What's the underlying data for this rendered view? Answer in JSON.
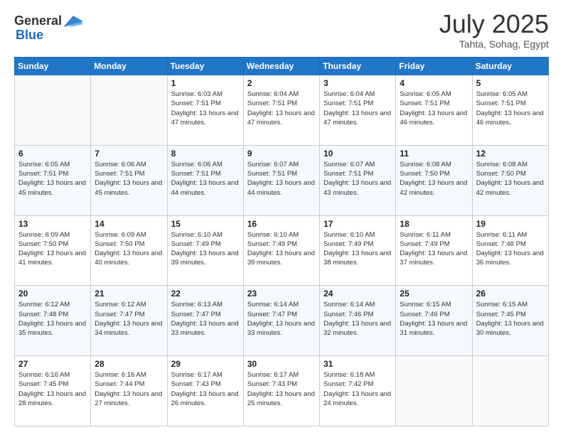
{
  "header": {
    "logo_general": "General",
    "logo_blue": "Blue",
    "title": "July 2025",
    "location": "Tahta, Sohag, Egypt"
  },
  "weekdays": [
    "Sunday",
    "Monday",
    "Tuesday",
    "Wednesday",
    "Thursday",
    "Friday",
    "Saturday"
  ],
  "weeks": [
    [
      {
        "day": "",
        "info": ""
      },
      {
        "day": "",
        "info": ""
      },
      {
        "day": "1",
        "info": "Sunrise: 6:03 AM\nSunset: 7:51 PM\nDaylight: 13 hours and 47 minutes."
      },
      {
        "day": "2",
        "info": "Sunrise: 6:04 AM\nSunset: 7:51 PM\nDaylight: 13 hours and 47 minutes."
      },
      {
        "day": "3",
        "info": "Sunrise: 6:04 AM\nSunset: 7:51 PM\nDaylight: 13 hours and 47 minutes."
      },
      {
        "day": "4",
        "info": "Sunrise: 6:05 AM\nSunset: 7:51 PM\nDaylight: 13 hours and 46 minutes."
      },
      {
        "day": "5",
        "info": "Sunrise: 6:05 AM\nSunset: 7:51 PM\nDaylight: 13 hours and 46 minutes."
      }
    ],
    [
      {
        "day": "6",
        "info": "Sunrise: 6:05 AM\nSunset: 7:51 PM\nDaylight: 13 hours and 45 minutes."
      },
      {
        "day": "7",
        "info": "Sunrise: 6:06 AM\nSunset: 7:51 PM\nDaylight: 13 hours and 45 minutes."
      },
      {
        "day": "8",
        "info": "Sunrise: 6:06 AM\nSunset: 7:51 PM\nDaylight: 13 hours and 44 minutes."
      },
      {
        "day": "9",
        "info": "Sunrise: 6:07 AM\nSunset: 7:51 PM\nDaylight: 13 hours and 44 minutes."
      },
      {
        "day": "10",
        "info": "Sunrise: 6:07 AM\nSunset: 7:51 PM\nDaylight: 13 hours and 43 minutes."
      },
      {
        "day": "11",
        "info": "Sunrise: 6:08 AM\nSunset: 7:50 PM\nDaylight: 13 hours and 42 minutes."
      },
      {
        "day": "12",
        "info": "Sunrise: 6:08 AM\nSunset: 7:50 PM\nDaylight: 13 hours and 42 minutes."
      }
    ],
    [
      {
        "day": "13",
        "info": "Sunrise: 6:09 AM\nSunset: 7:50 PM\nDaylight: 13 hours and 41 minutes."
      },
      {
        "day": "14",
        "info": "Sunrise: 6:09 AM\nSunset: 7:50 PM\nDaylight: 13 hours and 40 minutes."
      },
      {
        "day": "15",
        "info": "Sunrise: 6:10 AM\nSunset: 7:49 PM\nDaylight: 13 hours and 39 minutes."
      },
      {
        "day": "16",
        "info": "Sunrise: 6:10 AM\nSunset: 7:49 PM\nDaylight: 13 hours and 39 minutes."
      },
      {
        "day": "17",
        "info": "Sunrise: 6:10 AM\nSunset: 7:49 PM\nDaylight: 13 hours and 38 minutes."
      },
      {
        "day": "18",
        "info": "Sunrise: 6:11 AM\nSunset: 7:49 PM\nDaylight: 13 hours and 37 minutes."
      },
      {
        "day": "19",
        "info": "Sunrise: 6:11 AM\nSunset: 7:48 PM\nDaylight: 13 hours and 36 minutes."
      }
    ],
    [
      {
        "day": "20",
        "info": "Sunrise: 6:12 AM\nSunset: 7:48 PM\nDaylight: 13 hours and 35 minutes."
      },
      {
        "day": "21",
        "info": "Sunrise: 6:12 AM\nSunset: 7:47 PM\nDaylight: 13 hours and 34 minutes."
      },
      {
        "day": "22",
        "info": "Sunrise: 6:13 AM\nSunset: 7:47 PM\nDaylight: 13 hours and 33 minutes."
      },
      {
        "day": "23",
        "info": "Sunrise: 6:14 AM\nSunset: 7:47 PM\nDaylight: 13 hours and 33 minutes."
      },
      {
        "day": "24",
        "info": "Sunrise: 6:14 AM\nSunset: 7:46 PM\nDaylight: 13 hours and 32 minutes."
      },
      {
        "day": "25",
        "info": "Sunrise: 6:15 AM\nSunset: 7:46 PM\nDaylight: 13 hours and 31 minutes."
      },
      {
        "day": "26",
        "info": "Sunrise: 6:15 AM\nSunset: 7:45 PM\nDaylight: 13 hours and 30 minutes."
      }
    ],
    [
      {
        "day": "27",
        "info": "Sunrise: 6:16 AM\nSunset: 7:45 PM\nDaylight: 13 hours and 28 minutes."
      },
      {
        "day": "28",
        "info": "Sunrise: 6:16 AM\nSunset: 7:44 PM\nDaylight: 13 hours and 27 minutes."
      },
      {
        "day": "29",
        "info": "Sunrise: 6:17 AM\nSunset: 7:43 PM\nDaylight: 13 hours and 26 minutes."
      },
      {
        "day": "30",
        "info": "Sunrise: 6:17 AM\nSunset: 7:43 PM\nDaylight: 13 hours and 25 minutes."
      },
      {
        "day": "31",
        "info": "Sunrise: 6:18 AM\nSunset: 7:42 PM\nDaylight: 13 hours and 24 minutes."
      },
      {
        "day": "",
        "info": ""
      },
      {
        "day": "",
        "info": ""
      }
    ]
  ]
}
